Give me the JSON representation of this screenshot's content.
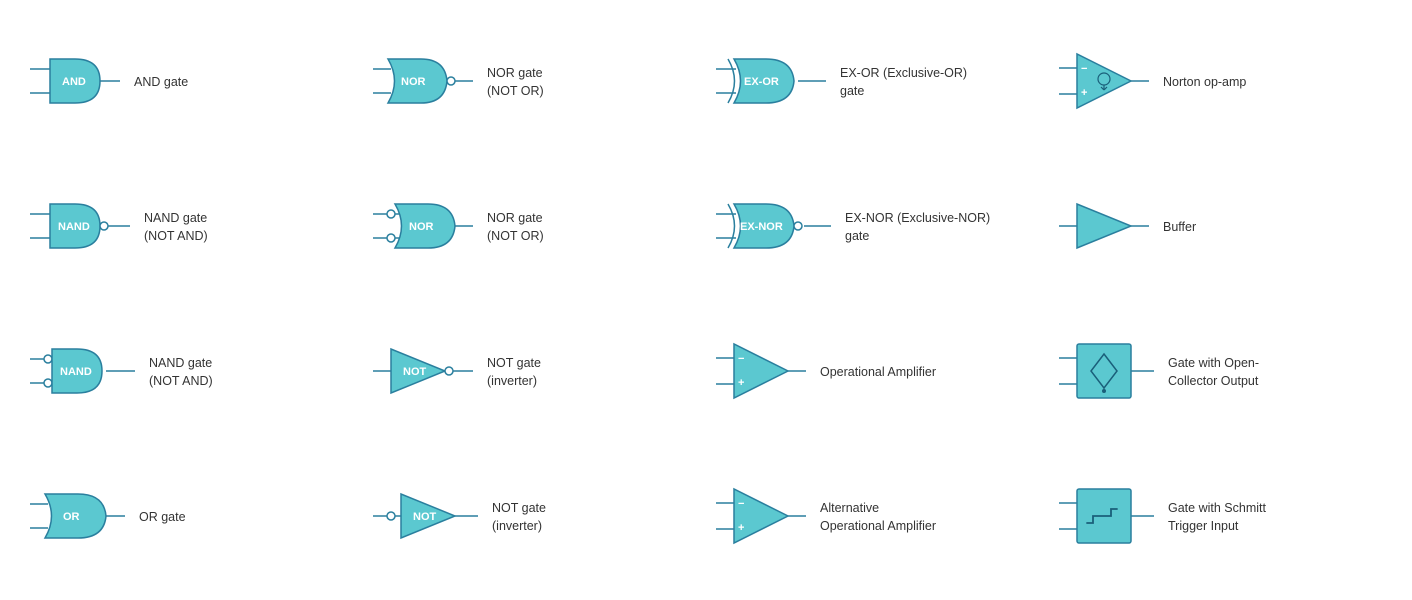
{
  "cells": [
    {
      "id": "and-gate",
      "label": "AND gate",
      "symbol_type": "and"
    },
    {
      "id": "nor-gate-1",
      "label": "NOR gate\n(NOT OR)",
      "symbol_type": "nor"
    },
    {
      "id": "exor-gate",
      "label": "EX-OR (Exclusive-OR)\ngate",
      "symbol_type": "exor"
    },
    {
      "id": "norton-opamp",
      "label": "Norton op-amp",
      "symbol_type": "norton_opamp"
    },
    {
      "id": "nand-gate-1",
      "label": "NAND gate\n(NOT AND)",
      "symbol_type": "nand"
    },
    {
      "id": "nor-gate-2",
      "label": "NOR gate\n(NOT OR)",
      "symbol_type": "nor2"
    },
    {
      "id": "exnor-gate",
      "label": "EX-NOR (Exclusive-NOR)\ngate",
      "symbol_type": "exnor"
    },
    {
      "id": "buffer",
      "label": "Buffer",
      "symbol_type": "buffer"
    },
    {
      "id": "nand-gate-2",
      "label": "NAND gate\n(NOT AND)",
      "symbol_type": "nand2"
    },
    {
      "id": "not-gate-1",
      "label": "NOT gate\n(inverter)",
      "symbol_type": "not"
    },
    {
      "id": "opamp",
      "label": "Operational Amplifier",
      "symbol_type": "opamp"
    },
    {
      "id": "open-collector",
      "label": "Gate with Open-\nCollector Output",
      "symbol_type": "open_collector"
    },
    {
      "id": "or-gate",
      "label": "OR gate",
      "symbol_type": "or"
    },
    {
      "id": "not-gate-2",
      "label": "NOT gate\n(inverter)",
      "symbol_type": "not2"
    },
    {
      "id": "alt-opamp",
      "label": "Alternative\nOperational Amplifier",
      "symbol_type": "alt_opamp"
    },
    {
      "id": "schmitt-trigger",
      "label": "Gate with Schmitt\nTrigger Input",
      "symbol_type": "schmitt"
    }
  ]
}
